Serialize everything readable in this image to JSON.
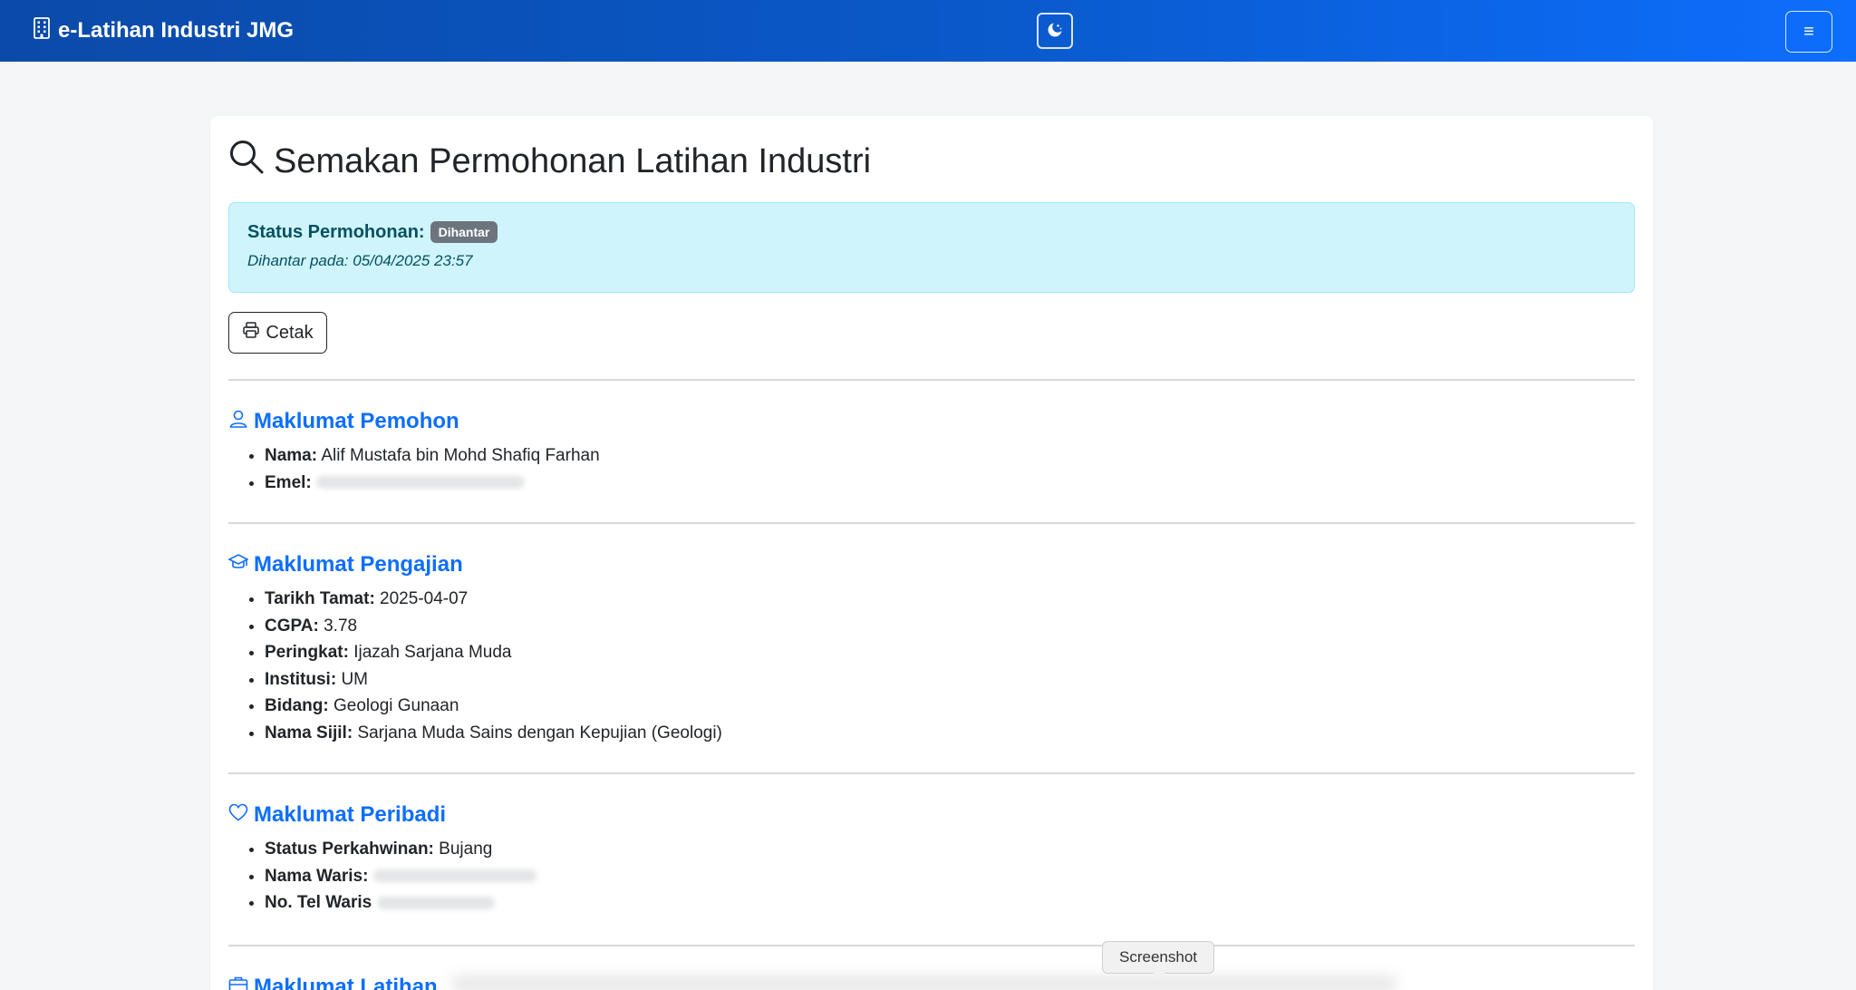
{
  "navbar": {
    "brand": "e-Latihan Industri JMG",
    "brand_icon": "building-icon",
    "theme_icon": "moon-stars-icon",
    "menu_icon": "hamburger-icon",
    "menu_glyph": "≡"
  },
  "page": {
    "title": "Semakan Permohonan Latihan Industri",
    "title_icon": "search-icon"
  },
  "status": {
    "label": "Status Permohonan:",
    "badge": "Dihantar",
    "date_text": "Dihantar pada: 05/04/2025 23:57"
  },
  "print_button": {
    "label": "Cetak",
    "icon": "printer-icon"
  },
  "sections": {
    "pemohon": {
      "title": "Maklumat Pemohon",
      "icon": "person-icon",
      "items": [
        {
          "label": "Nama:",
          "value": "Alif Mustafa bin Mohd Shafiq Farhan"
        },
        {
          "label": "Emel:",
          "value": ""
        }
      ]
    },
    "pengajian": {
      "title": "Maklumat Pengajian",
      "icon": "mortarboard-icon",
      "items": [
        {
          "label": "Tarikh Tamat:",
          "value": "2025-04-07"
        },
        {
          "label": "CGPA:",
          "value": "3.78"
        },
        {
          "label": "Peringkat:",
          "value": "Ijazah Sarjana Muda"
        },
        {
          "label": "Institusi:",
          "value": "UM"
        },
        {
          "label": "Bidang:",
          "value": "Geologi Gunaan"
        },
        {
          "label": "Nama Sijil:",
          "value": "Sarjana Muda Sains dengan Kepujian (Geologi)"
        }
      ]
    },
    "peribadi": {
      "title": "Maklumat Peribadi",
      "icon": "heart-icon",
      "items": [
        {
          "label": "Status Perkahwinan:",
          "value": "Bujang"
        },
        {
          "label": "Nama Waris:",
          "value": ""
        },
        {
          "label": "No. Tel Waris",
          "value": ""
        }
      ]
    },
    "latihan": {
      "title": "Maklumat Latihan",
      "icon": "briefcase-icon"
    }
  },
  "tooltip": {
    "text": "Screenshot"
  },
  "colors": {
    "navbar_start": "#0b4aa8",
    "navbar_end": "#0d6efd",
    "section_title": "#0d6efd",
    "alert_bg": "#cff4fc",
    "alert_text": "#055160",
    "badge_bg": "#6c757d"
  }
}
